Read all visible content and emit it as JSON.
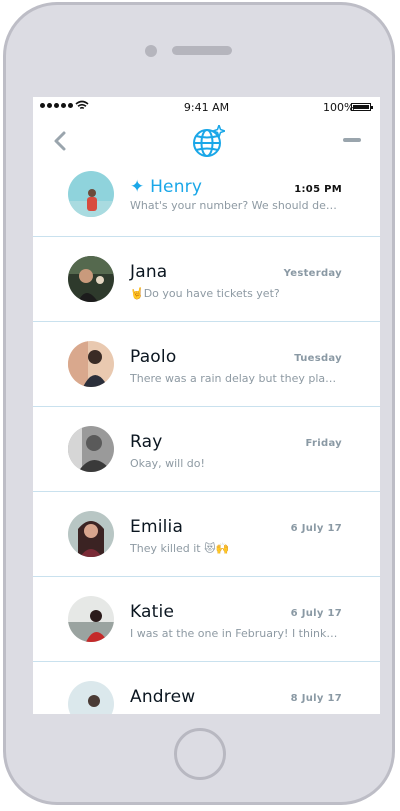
{
  "status": {
    "time": "9:41 AM",
    "battery": "100%"
  },
  "conversations": [
    {
      "prefix": "✦",
      "name": "Henry",
      "date": "1:05 PM",
      "preview": "What's your number? We should definitely meet up",
      "active": true
    },
    {
      "prefix": "",
      "name": "Jana",
      "date": "Yesterday",
      "preview": "🤘Do you have tickets yet?",
      "active": false
    },
    {
      "prefix": "",
      "name": "Paolo",
      "date": "Tuesday",
      "preview": "There was a rain delay but they played the whole game",
      "active": false
    },
    {
      "prefix": "",
      "name": "Ray",
      "date": "Friday",
      "preview": "Okay, will do!",
      "active": false
    },
    {
      "prefix": "",
      "name": "Emilia",
      "date": "6 July 17",
      "preview": "They killed it 😻🙌",
      "active": false
    },
    {
      "prefix": "",
      "name": "Katie",
      "date": "6 July 17",
      "preview": "I was at the one in February! I think they played",
      "active": false
    },
    {
      "prefix": "",
      "name": "Andrew",
      "date": "8 July 17",
      "preview": "",
      "active": false
    }
  ],
  "icons": {
    "back": "chevron-left-icon",
    "title": "globe-sparkle-icon",
    "menu": "minus-icon"
  },
  "colors": {
    "accent": "#1aa7e8",
    "divider": "#c9e1ee",
    "muted": "#8e9aa3"
  }
}
